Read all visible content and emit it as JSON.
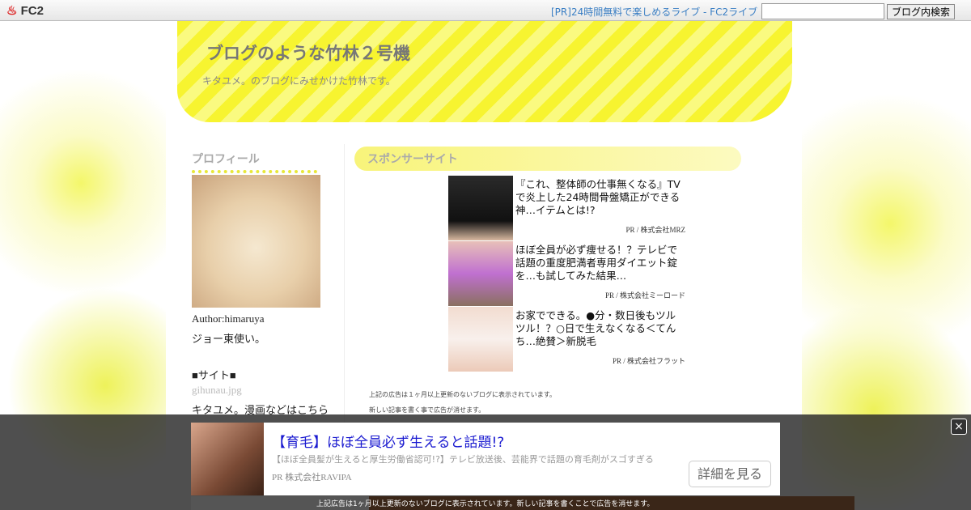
{
  "topbar": {
    "logo": "FC2",
    "pr_link": "[PR]24時間無料で楽しめるライブ - FC2ライブ",
    "search_value": "",
    "search_button": "ブログ内検索"
  },
  "blog": {
    "title": "ブログのような竹林２号機",
    "description": "キタユメ。のブログにみせかけた竹林です。"
  },
  "sidebar": {
    "heading": "プロフィール",
    "author": "Author:himaruya",
    "bio": "ジョー東使い。",
    "site_heading": "■サイト■",
    "image_alt": "gihunau.jpg",
    "site_text": "キタユメ。漫画などはこちら"
  },
  "sponsor": {
    "heading": "スポンサーサイト",
    "ads": [
      {
        "text": "『これ、整体師の仕事無くなる』TVで炎上した24時間骨盤矯正ができる神…イテムとは!?",
        "pr": "PR / 株式会社MRZ"
      },
      {
        "text": "ほぼ全員が必ず痩せる！？テレビで話題の重度肥満者専用ダイエット錠を…も試してみた結果…",
        "pr": "PR / 株式会社ミーロード"
      },
      {
        "text": "お家でできる。●分・数日後もツルツル！？○日で生えなくなる＜てんち…絶賛＞新脱毛",
        "pr": "PR / 株式会社フラット"
      }
    ],
    "note1": "上記の広告は１ヶ月以上更新のないブログに表示されています。",
    "note2": "新しい記事を書く事で広告が消せます。"
  },
  "overlay_ad": {
    "title": "【育毛】ほぼ全員必ず生えると話題!?",
    "subtitle": "【ほぼ全員髪が生えると厚生労働省認可!?】テレビ放送後、芸能界で話題の育毛剤がスゴすぎる",
    "pr": "PR  株式会社RAVIPA",
    "button": "詳細を見る",
    "close": "×",
    "footer": "上記広告は1ヶ月以上更新のないブログに表示されています。新しい記事を書くことで広告を消せます。"
  }
}
